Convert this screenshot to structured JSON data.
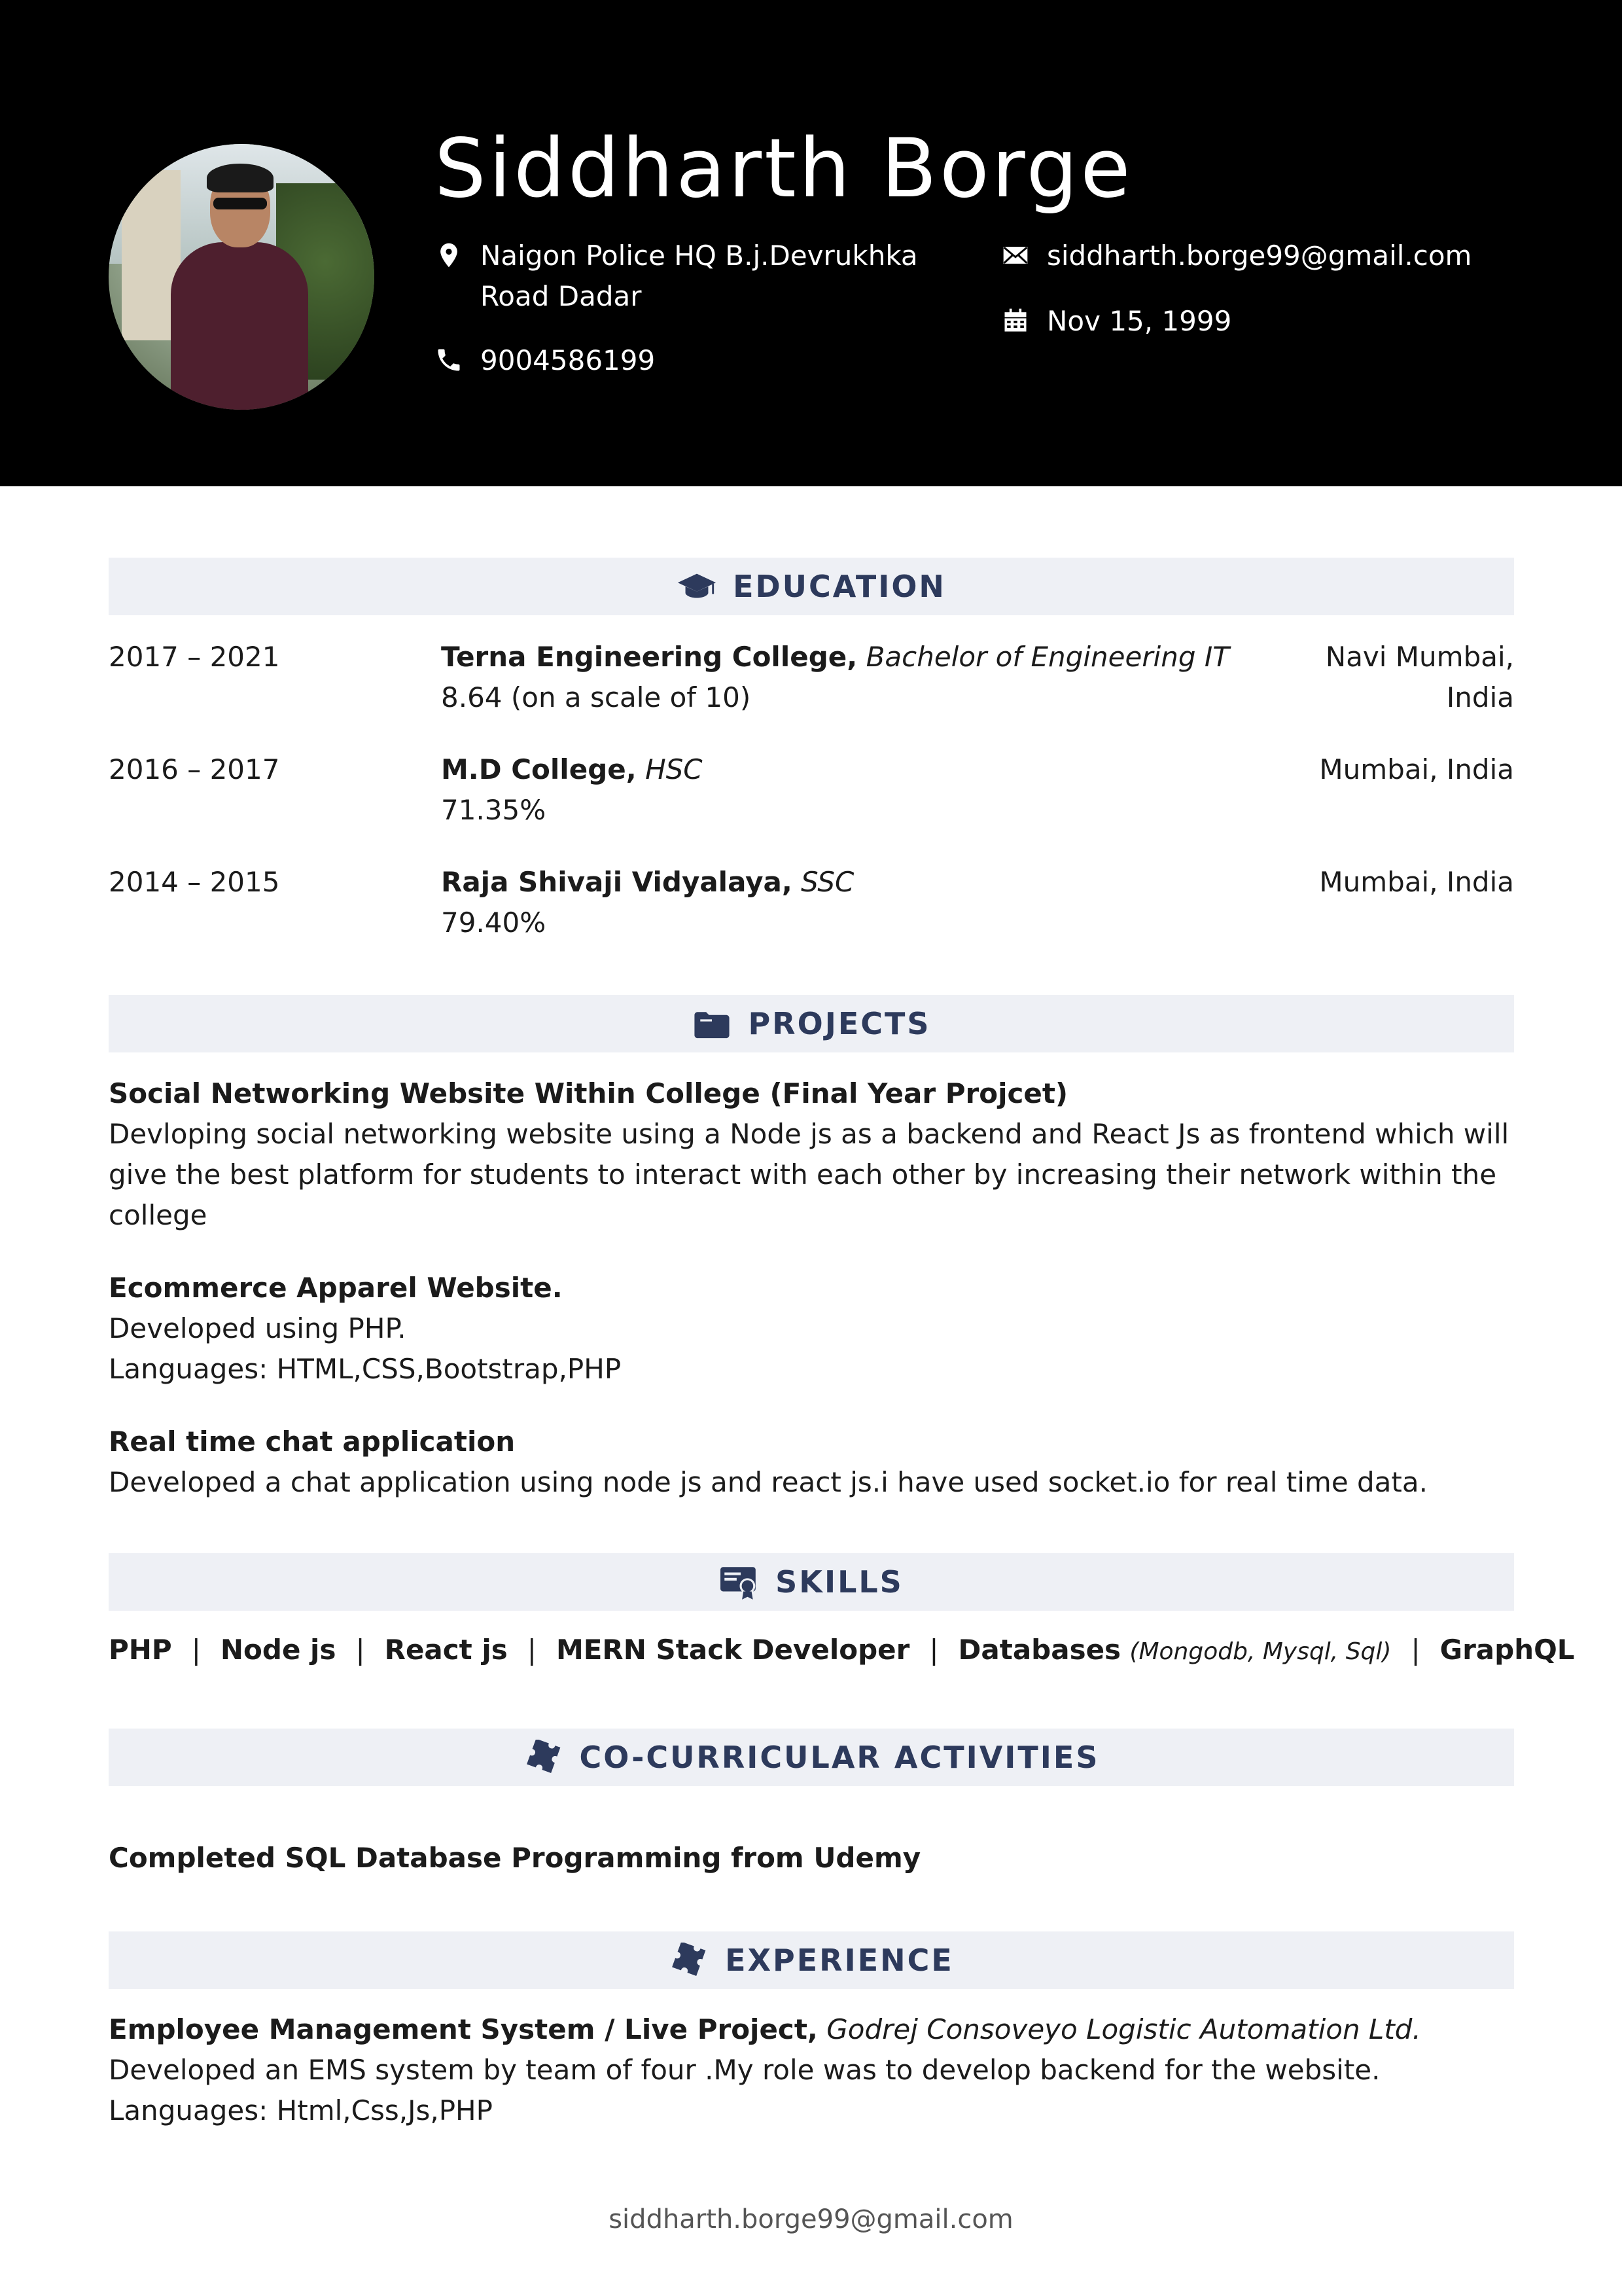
{
  "header": {
    "name": "Siddharth Borge",
    "address_line1": "Naigon Police HQ B.j.Devrukhka",
    "address_line2": "Road Dadar",
    "phone": "9004586199",
    "email": "siddharth.borge99@gmail.com",
    "dob": "Nov 15, 1999"
  },
  "education": {
    "title": "EDUCATION",
    "entries": [
      {
        "dates": "2017 – 2021",
        "institution": "Terna Engineering College,",
        "degree": "Bachelor of Engineering IT",
        "score": "8.64 (on a scale of 10)",
        "location_line1": "Navi Mumbai,",
        "location_line2": "India"
      },
      {
        "dates": "2016 – 2017",
        "institution": "M.D College,",
        "degree": "HSC",
        "score": "71.35%",
        "location_line1": "Mumbai, India"
      },
      {
        "dates": "2014 – 2015",
        "institution": "Raja Shivaji Vidyalaya,",
        "degree": "SSC",
        "score": "79.40%",
        "location_line1": "Mumbai, India"
      }
    ]
  },
  "projects": {
    "title": "PROJECTS",
    "items": [
      {
        "name": "Social Networking Website Within College (Final Year Projcet)",
        "lines": [
          "Devloping social networking website using a Node js as a backend and React Js as frontend which will",
          "give the best platform for students to interact with each other by increasing their network within the",
          "college"
        ]
      },
      {
        "name": "Ecommerce Apparel Website.",
        "lines": [
          "Developed using PHP.",
          "Languages: HTML,CSS,Bootstrap,PHP"
        ]
      },
      {
        "name": "Real time chat application",
        "lines": [
          "Developed a chat application using node js and react js.i have used socket.io for real time data."
        ]
      }
    ]
  },
  "skills": {
    "title": "SKILLS",
    "items": [
      "PHP",
      "Node js",
      "React js",
      "MERN Stack Developer",
      "Databases",
      "GraphQL"
    ],
    "databases_detail": "(Mongodb, Mysql, Sql)",
    "separator": "|"
  },
  "cocurricular": {
    "title": "CO-CURRICULAR ACTIVITIES",
    "item": "Completed SQL Database Programming from Udemy"
  },
  "experience": {
    "title": "EXPERIENCE",
    "role": "Employee Management System / Live Project,",
    "company": "Godrej Consoveyo Logistic Automation Ltd.",
    "lines": [
      "Developed an EMS system by team of four .My role was to develop backend for the website.",
      "Languages: Html,Css,Js,PHP"
    ]
  },
  "footer": {
    "email": "siddharth.borge99@gmail.com"
  },
  "colors": {
    "header_bg": "#000000",
    "section_bar_bg": "#eef0f5",
    "section_title": "#2d3a5c"
  },
  "icons": [
    "map-pin-icon",
    "phone-icon",
    "envelope-icon",
    "calendar-icon",
    "graduation-cap-icon",
    "folder-icon",
    "certificate-icon",
    "puzzle-piece-icon"
  ]
}
